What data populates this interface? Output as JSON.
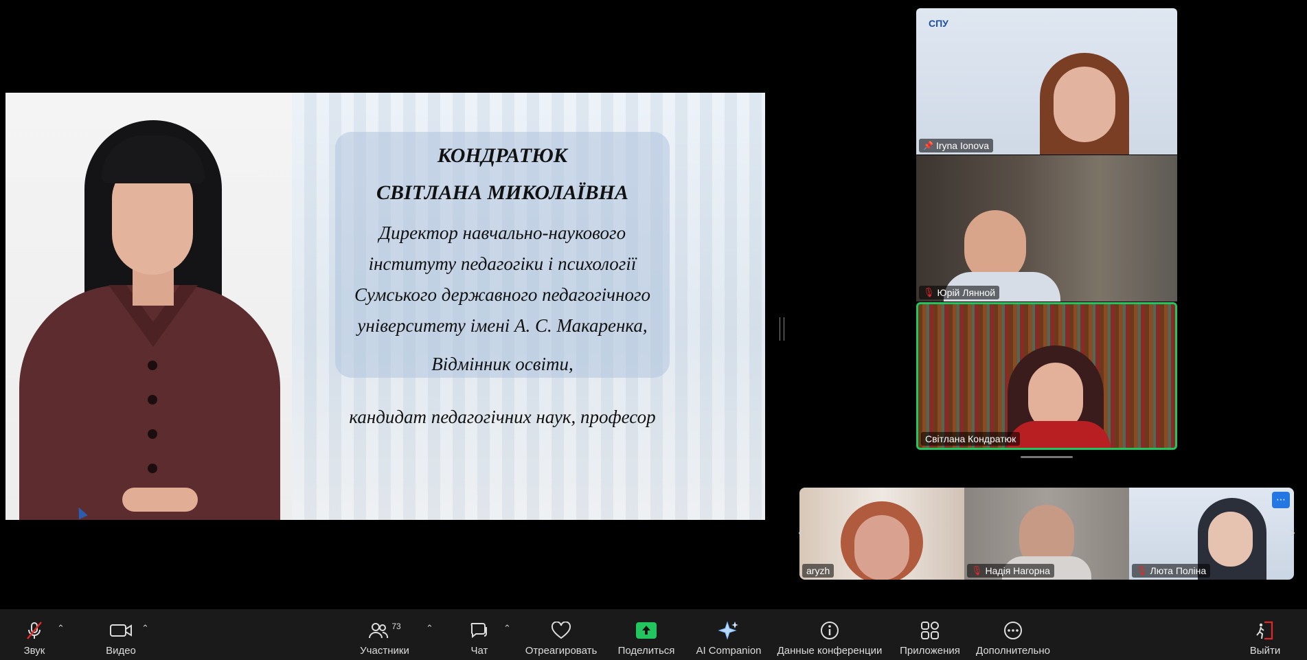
{
  "slide": {
    "lines": [
      "КОНДРАТЮК",
      "СВІТЛАНА МИКОЛАЇВНА",
      "Директор навчально-наукового",
      "інституту педагогіки і психології",
      "Сумського державного педагогічного",
      "університету імені А. С. Макаренка,",
      "Відмінник освіти,",
      "кандидат педагогічних наук, професор"
    ]
  },
  "participants": [
    {
      "name": "Iryna Ionova",
      "status": "pinned"
    },
    {
      "name": "Юрій Лянной",
      "status": "muted"
    },
    {
      "name": "Світлана Кондратюк",
      "status": "active-speaker"
    },
    {
      "name": "aryzh",
      "status": "none"
    },
    {
      "name": "Надія Нагорна",
      "status": "muted"
    },
    {
      "name": "Люта Поліна",
      "status": "muted"
    }
  ],
  "tile_banner": {
    "logo_text": "СПУ"
  },
  "toolbar": {
    "audio_label": "Звук",
    "video_label": "Видео",
    "participants_label": "Участники",
    "participants_count": "73",
    "chat_label": "Чат",
    "react_label": "Отреагировать",
    "share_label": "Поделиться",
    "ai_label": "AI Companion",
    "info_label": "Данные конференции",
    "apps_label": "Приложения",
    "more_label": "Дополнительно",
    "leave_label": "Выйти"
  },
  "colors": {
    "active_speaker_border": "#22c55e",
    "share_green": "#22c55e",
    "muted_red": "#e02828",
    "toolbar_bg": "#1a1a1a"
  }
}
